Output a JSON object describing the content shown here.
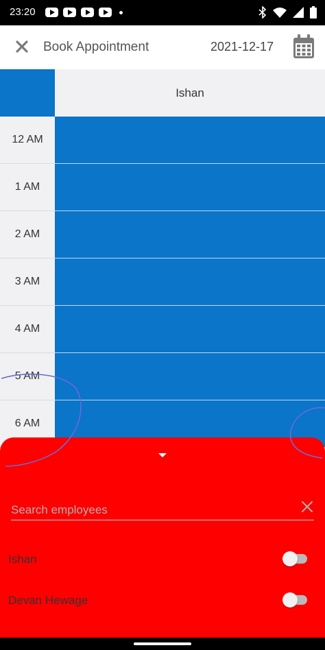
{
  "status_bar": {
    "time": "23:20",
    "left_icons": [
      "youtube-icon",
      "youtube-icon",
      "youtube-icon",
      "youtube-icon",
      "notification-dot-icon"
    ],
    "right_icons": [
      "bluetooth-icon",
      "wifi-icon",
      "signal-icon",
      "battery-icon"
    ]
  },
  "header": {
    "close_icon": "close-icon",
    "title": "Book Appointment",
    "date": "2021-12-17",
    "calendar_icon": "calendar-icon"
  },
  "schedule": {
    "column_header": "Ishan",
    "time_rows": [
      "12 AM",
      "1 AM",
      "2 AM",
      "3 AM",
      "4 AM",
      "5 AM",
      "6 AM"
    ]
  },
  "bottom_sheet": {
    "search_placeholder": "Search employees",
    "search_value": "",
    "employees": [
      {
        "name": "Ishan",
        "enabled": false
      },
      {
        "name": "Devan Hewage",
        "enabled": false
      }
    ]
  },
  "colors": {
    "accent": "#0a75c9",
    "sheet_background": "#ff0000",
    "header_background": "#ffffff",
    "label_background": "#f1f1f3"
  }
}
